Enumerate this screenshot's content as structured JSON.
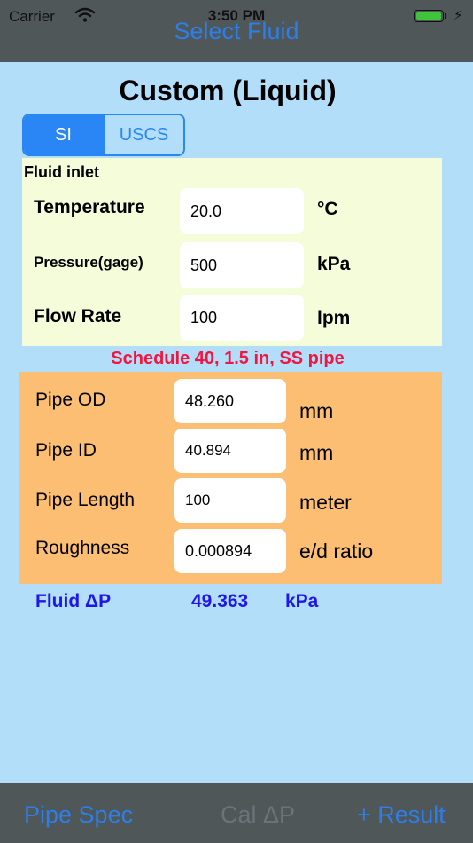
{
  "status": {
    "carrier": "Carrier",
    "time": "3:50 PM"
  },
  "nav": {
    "title": "Select Fluid"
  },
  "title": "Custom (Liquid)",
  "units": {
    "si": "SI",
    "uscs": "USCS",
    "selected": "SI"
  },
  "inlet": {
    "header": "Fluid inlet",
    "temperature": {
      "label": "Temperature",
      "value": "20.0",
      "unit": "°C"
    },
    "pressure": {
      "label": "Pressure(gage)",
      "value": "500",
      "unit": "kPa"
    },
    "flow": {
      "label": "Flow Rate",
      "value": "100",
      "unit": "lpm"
    }
  },
  "pipe_note": "Schedule 40, 1.5 in, SS pipe",
  "pipe": {
    "od": {
      "label": "Pipe OD",
      "value": "48.260",
      "unit": "mm"
    },
    "id": {
      "label": "Pipe ID",
      "value": "40.894",
      "unit": "mm"
    },
    "length": {
      "label": "Pipe Length",
      "value": "100",
      "unit": "meter"
    },
    "roughness": {
      "label": "Roughness",
      "value": "0.000894",
      "unit": "e/d ratio"
    }
  },
  "result": {
    "label": "Fluid ΔP",
    "value": "49.363",
    "unit": "kPa"
  },
  "tabs": {
    "pipe_spec": "Pipe Spec",
    "cal": "Cal ΔP",
    "result": "+ Result"
  },
  "colors": {
    "bar": "#4f5759",
    "background": "#b3defa",
    "accent": "#2d7ee7",
    "inlet_panel": "#f5fcd9",
    "pipe_panel": "#fcbe72",
    "note": "#f0163f",
    "result": "#1f17e8"
  }
}
